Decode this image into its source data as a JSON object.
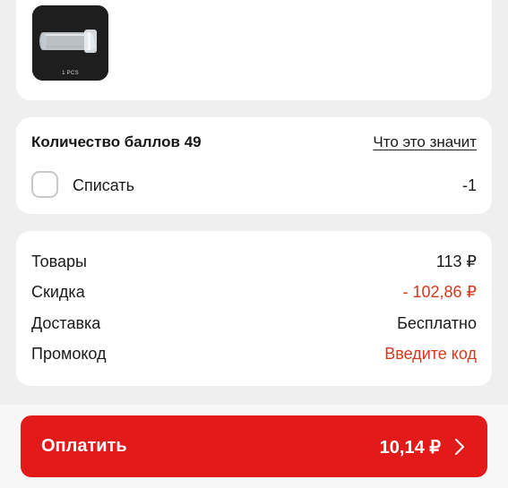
{
  "product": {
    "thumbnail_caption": "1 PCS"
  },
  "points": {
    "title": "Количество баллов 49",
    "link": "Что это значит",
    "checkbox_label": "Списать",
    "value": "-1"
  },
  "summary": {
    "rows": [
      {
        "label": "Товары",
        "value": "113 ₽"
      },
      {
        "label": "Скидка",
        "value": "- 102,86 ₽"
      },
      {
        "label": "Доставка",
        "value": "Бесплатно"
      },
      {
        "label": "Промокод",
        "value": "Введите код"
      }
    ]
  },
  "pay": {
    "label": "Оплатить",
    "amount": "10,14 ₽"
  },
  "colors": {
    "accent": "#e21a1a",
    "discount": "#d6381c",
    "background": "#efefef",
    "card": "#ffffff"
  }
}
